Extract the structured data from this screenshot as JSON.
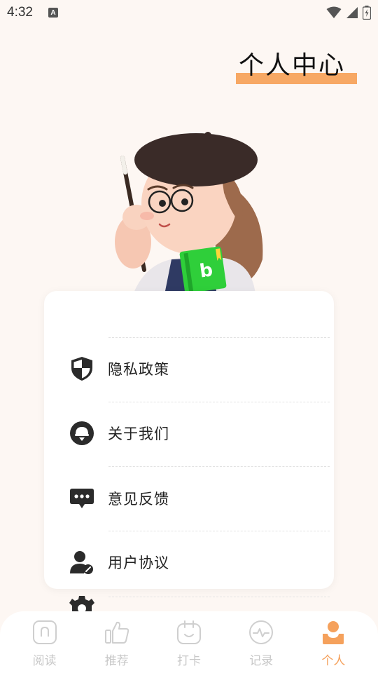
{
  "status_bar": {
    "time": "4:32",
    "notification_icon_letter": "A",
    "icons": [
      "wifi-icon",
      "signal-icon",
      "battery-charging-icon"
    ]
  },
  "header": {
    "title": "个人中心",
    "accent_color": "#f7a864"
  },
  "menu": {
    "items": [
      {
        "label": "隐私政策",
        "icon": "shield-icon"
      },
      {
        "label": "关于我们",
        "icon": "about-us-icon"
      },
      {
        "label": "意见反馈",
        "icon": "feedback-chat-icon"
      },
      {
        "label": "用户协议",
        "icon": "user-agreement-icon"
      }
    ],
    "partial_item_icon": "settings-gear-icon"
  },
  "bottom_nav": {
    "active_index": 4,
    "active_color": "#f5a15c",
    "inactive_color": "#c8c8c8",
    "items": [
      {
        "label": "阅读",
        "icon": "read-icon"
      },
      {
        "label": "推荐",
        "icon": "thumbs-up-icon"
      },
      {
        "label": "打卡",
        "icon": "check-in-icon"
      },
      {
        "label": "记录",
        "icon": "record-pulse-icon"
      },
      {
        "label": "个人",
        "icon": "profile-icon"
      }
    ]
  }
}
